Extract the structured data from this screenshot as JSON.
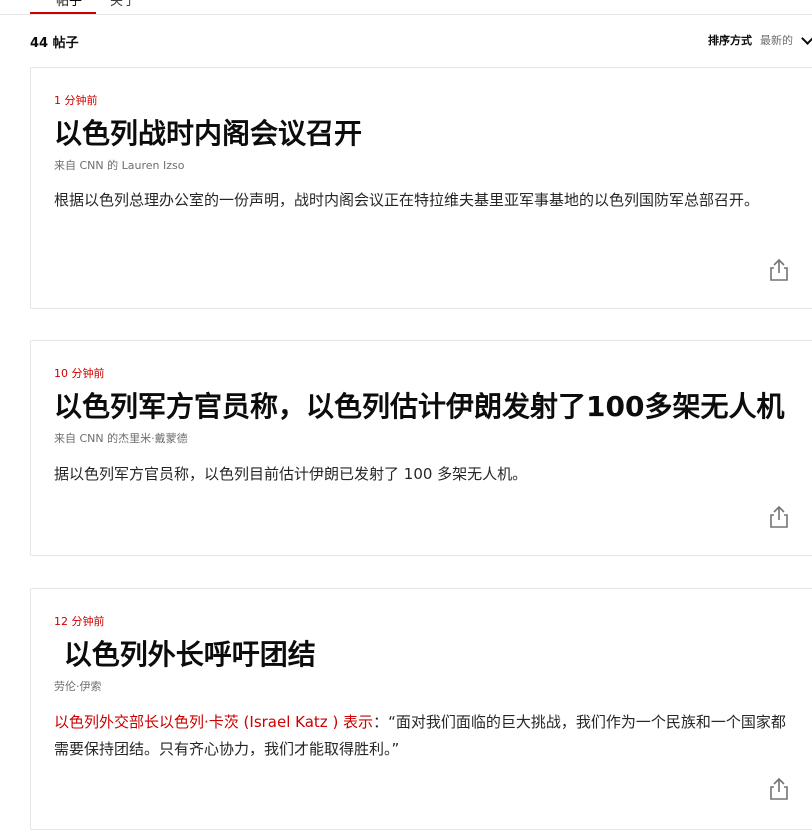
{
  "tabs": [
    {
      "label": "帖子",
      "active": true
    },
    {
      "label": "关于",
      "active": false
    }
  ],
  "post_count": "44 帖子",
  "sort": {
    "label": "排序方式",
    "value": "最新的"
  },
  "posts": [
    {
      "time": "1 分钟前",
      "headline": "以色列战时内阁会议召开",
      "byline": "来自 CNN 的 Lauren Izso",
      "body": "根据以色列总理办公室的一份声明，战时内阁会议正在特拉维夫基里亚军事基地的以色列国防军总部召开。"
    },
    {
      "time": "10 分钟前",
      "headline": "以色列军方官员称，以色列估计伊朗发射了100多架无人机",
      "byline": "来自 CNN 的杰里米·戴蒙德",
      "body": "据以色列军方官员称，以色列目前估计伊朗已发射了 100 多架无人机。"
    },
    {
      "time": "12 分钟前",
      "headline": " 以色列外长呼吁团结",
      "byline": "劳伦·伊索",
      "body_link": "以色列外交部长以色列·卡茨 (Israel Katz ) 表示",
      "body": "：“面对我们面临的巨大挑战，我们作为一个民族和一个国家都需要保持团结。只有齐心协力，我们才能取得胜利。”"
    }
  ],
  "colors": {
    "accent": "#cc0000",
    "border": "#e6e6e6",
    "muted": "#6e6e6e"
  },
  "icons": {
    "share": "share-icon",
    "sort": "chevron-down-icon"
  }
}
